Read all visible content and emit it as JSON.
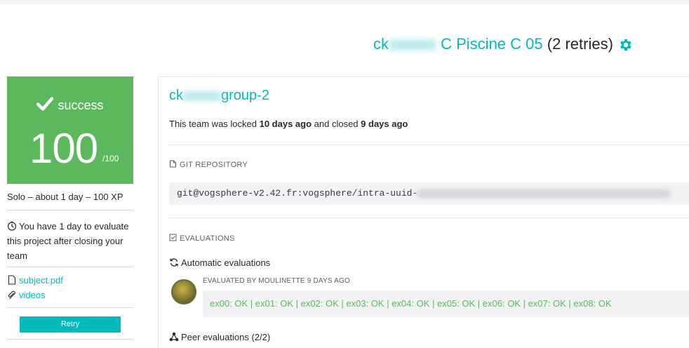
{
  "header": {
    "login_prefix": "ck",
    "project_name": "C Piscine C 05",
    "retries": "(2 retries)"
  },
  "status": {
    "label": "success",
    "score": "100",
    "max": "/100",
    "color": "#5cb85c"
  },
  "sidebar": {
    "meta": "Solo – about 1 day – 100 XP",
    "eval_note": "You have 1 day to evaluate this project after closing your team",
    "subject_link": "subject.pdf",
    "videos_link": "videos",
    "retry_label": "Retry"
  },
  "team": {
    "name_prefix": "ck",
    "name_suffix": "group-2",
    "status_pre": "This team was locked ",
    "locked_ago": "10 days ago",
    "status_mid": " and closed ",
    "closed_ago": "9 days ago"
  },
  "git": {
    "label": "GIT REPOSITORY",
    "url_prefix": "git@vogsphere-v2.42.fr:vogsphere/intra-uuid-"
  },
  "evaluations": {
    "label": "EVALUATIONS",
    "automatic_label": "Automatic evaluations",
    "evaluated_by": "EVALUATED BY MOULINETTE 9 DAYS AGO",
    "result": "ex00: OK | ex01: OK | ex02: OK | ex03: OK | ex04: OK | ex05: OK | ex06: OK | ex07: OK | ex08: OK",
    "peer_label": "Peer evaluations (2/2)"
  },
  "colors": {
    "accent": "#00babc",
    "success": "#5cb85c"
  },
  "icons": [
    "gear-icon",
    "check-icon",
    "clock-icon",
    "file-icon",
    "paperclip-icon",
    "repo-icon",
    "checklist-icon",
    "sync-icon",
    "peer-icon"
  ]
}
